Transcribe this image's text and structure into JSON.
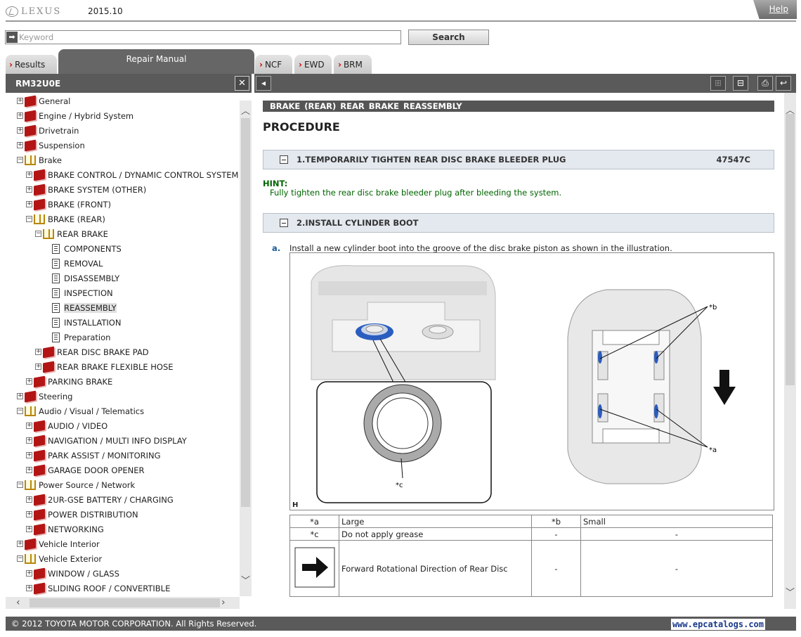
{
  "header": {
    "brand": "LEXUS",
    "version": "2015.10",
    "help": "Help"
  },
  "search": {
    "placeholder": "Keyword",
    "button": "Search"
  },
  "tabs": {
    "results": "Results",
    "repair": "Repair Manual",
    "ncf": "NCF",
    "ewd": "EWD",
    "brm": "BRM"
  },
  "left_panel": {
    "code": "RM32U0E",
    "close": "✕"
  },
  "tree": [
    {
      "label": "General",
      "level": 0,
      "kind": "closed",
      "toggle": "+"
    },
    {
      "label": "Engine / Hybrid System",
      "level": 0,
      "kind": "closed",
      "toggle": "+"
    },
    {
      "label": "Drivetrain",
      "level": 0,
      "kind": "closed",
      "toggle": "+"
    },
    {
      "label": "Suspension",
      "level": 0,
      "kind": "closed",
      "toggle": "+"
    },
    {
      "label": "Brake",
      "level": 0,
      "kind": "open",
      "toggle": "−"
    },
    {
      "label": "BRAKE CONTROL / DYNAMIC CONTROL SYSTEMS",
      "level": 1,
      "kind": "closed",
      "toggle": "+"
    },
    {
      "label": "BRAKE SYSTEM (OTHER)",
      "level": 1,
      "kind": "closed",
      "toggle": "+"
    },
    {
      "label": "BRAKE (FRONT)",
      "level": 1,
      "kind": "closed",
      "toggle": "+"
    },
    {
      "label": "BRAKE (REAR)",
      "level": 1,
      "kind": "open",
      "toggle": "−"
    },
    {
      "label": "REAR BRAKE",
      "level": 2,
      "kind": "open",
      "toggle": "−"
    },
    {
      "label": "COMPONENTS",
      "level": 3,
      "kind": "doc",
      "toggle": ""
    },
    {
      "label": "REMOVAL",
      "level": 3,
      "kind": "doc",
      "toggle": ""
    },
    {
      "label": "DISASSEMBLY",
      "level": 3,
      "kind": "doc",
      "toggle": ""
    },
    {
      "label": "INSPECTION",
      "level": 3,
      "kind": "doc",
      "toggle": ""
    },
    {
      "label": "REASSEMBLY",
      "level": 3,
      "kind": "doc",
      "toggle": "",
      "selected": true
    },
    {
      "label": "INSTALLATION",
      "level": 3,
      "kind": "doc",
      "toggle": ""
    },
    {
      "label": "Preparation",
      "level": 3,
      "kind": "doc",
      "toggle": ""
    },
    {
      "label": "REAR DISC BRAKE PAD",
      "level": 2,
      "kind": "closed",
      "toggle": "+"
    },
    {
      "label": "REAR BRAKE FLEXIBLE HOSE",
      "level": 2,
      "kind": "closed",
      "toggle": "+"
    },
    {
      "label": "PARKING BRAKE",
      "level": 1,
      "kind": "closed",
      "toggle": "+"
    },
    {
      "label": "Steering",
      "level": 0,
      "kind": "closed",
      "toggle": "+"
    },
    {
      "label": "Audio / Visual / Telematics",
      "level": 0,
      "kind": "open",
      "toggle": "−"
    },
    {
      "label": "AUDIO / VIDEO",
      "level": 1,
      "kind": "closed",
      "toggle": "+"
    },
    {
      "label": "NAVIGATION / MULTI INFO DISPLAY",
      "level": 1,
      "kind": "closed",
      "toggle": "+"
    },
    {
      "label": "PARK ASSIST / MONITORING",
      "level": 1,
      "kind": "closed",
      "toggle": "+"
    },
    {
      "label": "GARAGE DOOR OPENER",
      "level": 1,
      "kind": "closed",
      "toggle": "+"
    },
    {
      "label": "Power Source / Network",
      "level": 0,
      "kind": "open",
      "toggle": "−"
    },
    {
      "label": "2UR-GSE BATTERY / CHARGING",
      "level": 1,
      "kind": "closed",
      "toggle": "+"
    },
    {
      "label": "POWER DISTRIBUTION",
      "level": 1,
      "kind": "closed",
      "toggle": "+"
    },
    {
      "label": "NETWORKING",
      "level": 1,
      "kind": "closed",
      "toggle": "+"
    },
    {
      "label": "Vehicle Interior",
      "level": 0,
      "kind": "closed",
      "toggle": "+"
    },
    {
      "label": "Vehicle Exterior",
      "level": 0,
      "kind": "open",
      "toggle": "−"
    },
    {
      "label": "WINDOW / GLASS",
      "level": 1,
      "kind": "closed",
      "toggle": "+"
    },
    {
      "label": "SLIDING ROOF / CONVERTIBLE",
      "level": 1,
      "kind": "closed",
      "toggle": "+"
    }
  ],
  "content": {
    "breadcrumb": "BRAKE (REAR)  REAR BRAKE  REASSEMBLY",
    "title": "PROCEDURE",
    "step1": {
      "label": "1.TEMPORARILY TIGHTEN REAR DISC BRAKE BLEEDER PLUG",
      "code": "47547C"
    },
    "hint_label": "HINT:",
    "hint_text": "Fully tighten the rear disc brake bleeder plug after bleeding the system.",
    "step2": {
      "label": "2.INSTALL CYLINDER BOOT"
    },
    "sub_a": {
      "marker": "a.",
      "text": "Install a new cylinder boot into the groove of the disc brake piston as shown in the illustration."
    },
    "illustration": {
      "letter": "H",
      "callout_a": "*a",
      "callout_b": "*b",
      "callout_c": "*c"
    },
    "legend": [
      {
        "k": "*a",
        "v": "Large",
        "k2": "*b",
        "v2": "Small"
      },
      {
        "k": "*c",
        "v": "Do not apply grease",
        "k2": "-",
        "v2": "-"
      },
      {
        "k": "",
        "v": "Forward Rotational Direction of Rear Disc",
        "k2": "-",
        "v2": "-"
      }
    ]
  },
  "footer": {
    "copyright": "© 2012 TOYOTA MOTOR CORPORATION. All Rights Reserved.",
    "site": "www.epcatalogs.com"
  },
  "colors": {
    "toolbar": "#5a5a5a",
    "hint": "#006400",
    "accent": "#d00000",
    "step_bg": "#e4e9ef"
  }
}
